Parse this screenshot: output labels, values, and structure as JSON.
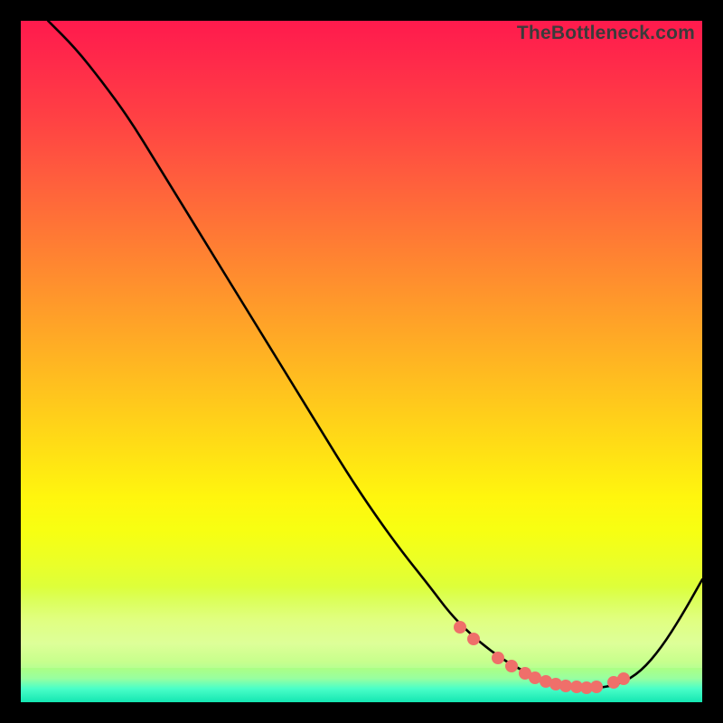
{
  "watermark": "TheBottleneck.com",
  "chart_data": {
    "type": "line",
    "title": "",
    "subtitle": "",
    "xlabel": "",
    "ylabel": "",
    "xlim": [
      0,
      100
    ],
    "ylim": [
      0,
      100
    ],
    "grid": false,
    "series": [
      {
        "name": "curve",
        "x": [
          4,
          8,
          12,
          16,
          20,
          24,
          28,
          32,
          36,
          40,
          44,
          48,
          52,
          56,
          60,
          63,
          66,
          69,
          72,
          75,
          77,
          79,
          81,
          83,
          85,
          88,
          91,
          94,
          97,
          100
        ],
        "y": [
          100,
          96,
          91,
          85.5,
          79,
          72.5,
          66,
          59.5,
          53,
          46.5,
          40,
          33.5,
          27.5,
          22,
          17,
          13,
          10,
          7.5,
          5.5,
          4,
          3,
          2.4,
          2.1,
          2.0,
          2.1,
          2.7,
          4.5,
          8,
          12.7,
          18
        ]
      }
    ],
    "dots": {
      "name": "highlighted-points",
      "x": [
        64.5,
        66.5,
        70,
        72,
        74,
        75.5,
        77,
        78.5,
        80,
        81.5,
        83,
        84.5,
        87,
        88.5
      ],
      "y": [
        11,
        9.3,
        6.5,
        5.3,
        4.3,
        3.6,
        3.1,
        2.7,
        2.4,
        2.25,
        2.15,
        2.2,
        2.9,
        3.4
      ]
    },
    "gradient_description": "red(top) → orange → yellow → pale → green(bottom)"
  }
}
